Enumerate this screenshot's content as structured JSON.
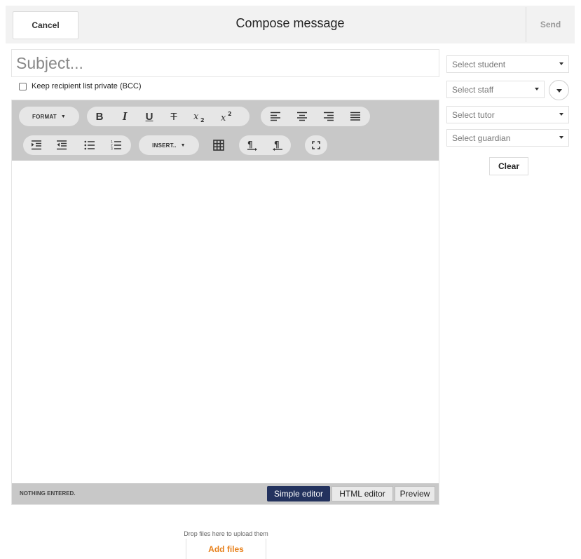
{
  "header": {
    "cancel_label": "Cancel",
    "title": "Compose message",
    "send_label": "Send"
  },
  "subject": {
    "placeholder": "Subject...",
    "value": ""
  },
  "bcc": {
    "label": "Keep recipient list private (BCC)",
    "checked": false
  },
  "toolbar": {
    "format_label": "FORMAT",
    "bold_label": "B",
    "italic_label": "I",
    "underline_label": "U",
    "strike_label": "T",
    "insert_label": "INSERT..",
    "icons": [
      "format-dropdown-icon",
      "bold-icon",
      "italic-icon",
      "underline-icon",
      "strikethrough-icon",
      "subscript-icon",
      "superscript-icon",
      "align-left-icon",
      "align-center-icon",
      "align-right-icon",
      "align-justify-icon",
      "indent-icon",
      "outdent-icon",
      "bullet-list-icon",
      "numbered-list-icon",
      "insert-dropdown-icon",
      "table-icon",
      "ltr-paragraph-icon",
      "rtl-paragraph-icon",
      "fullscreen-icon"
    ]
  },
  "editor": {
    "status_text": "NOTHING ENTERED.",
    "modes": [
      "Simple editor",
      "HTML editor",
      "Preview"
    ],
    "active_mode": "Simple editor"
  },
  "recipients": {
    "student_placeholder": "Select student",
    "staff_placeholder": "Select staff",
    "tutor_placeholder": "Select tutor",
    "guardian_placeholder": "Select guardian",
    "clear_label": "Clear"
  },
  "upload": {
    "hint": "Drop files here to upload them",
    "add_label": "Add files"
  },
  "colors": {
    "header_bg": "#f2f2f2",
    "toolbar_bg": "#c8c8c8",
    "active_mode_bg": "#23325e",
    "accent_orange": "#e8821e"
  }
}
